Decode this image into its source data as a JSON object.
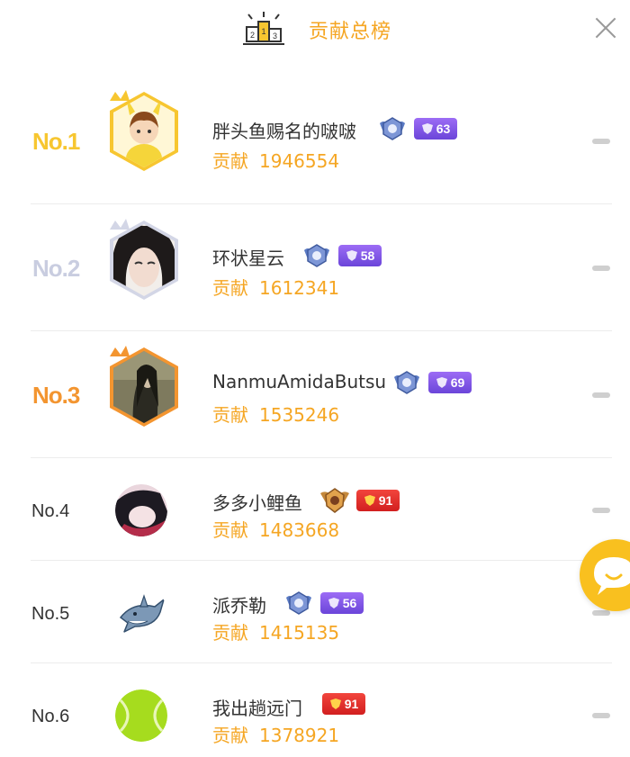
{
  "header": {
    "title": "贡献总榜",
    "icon": "podium-icon",
    "close_icon": "close-icon"
  },
  "colors": {
    "accent": "#f5a623",
    "gold": "#f7c630",
    "silver": "#c9cde0",
    "bronze": "#f39530",
    "level_purple": "#7a52e6",
    "level_red": "#e1302a"
  },
  "rows": [
    {
      "rank": "No.1",
      "name": "胖头鱼赐名的啵啵",
      "contrib_label": "贡献",
      "contrib_value": "1946554",
      "level": "63",
      "level_color": "purple",
      "emblem": "diamond-rank-emblem"
    },
    {
      "rank": "No.2",
      "name": "环状星云",
      "contrib_label": "贡献",
      "contrib_value": "1612341",
      "level": "58",
      "level_color": "purple",
      "emblem": "diamond-rank-emblem"
    },
    {
      "rank": "No.3",
      "name": "NanmuAmidaButsu",
      "contrib_label": "贡献",
      "contrib_value": "1535246",
      "level": "69",
      "level_color": "purple",
      "emblem": "diamond-rank-emblem"
    },
    {
      "rank": "No.4",
      "name": "多多小鲤鱼",
      "contrib_label": "贡献",
      "contrib_value": "1483668",
      "level": "91",
      "level_color": "red",
      "emblem": "gold-wing-rank-emblem"
    },
    {
      "rank": "No.5",
      "name": "派乔勒",
      "contrib_label": "贡献",
      "contrib_value": "1415135",
      "level": "56",
      "level_color": "purple",
      "emblem": "diamond-rank-emblem"
    },
    {
      "rank": "No.6",
      "name": "我出趟远门",
      "contrib_label": "贡献",
      "contrib_value": "1378921",
      "level": "91",
      "level_color": "red",
      "emblem": ""
    }
  ],
  "floating_button": "chat-bubble-icon"
}
